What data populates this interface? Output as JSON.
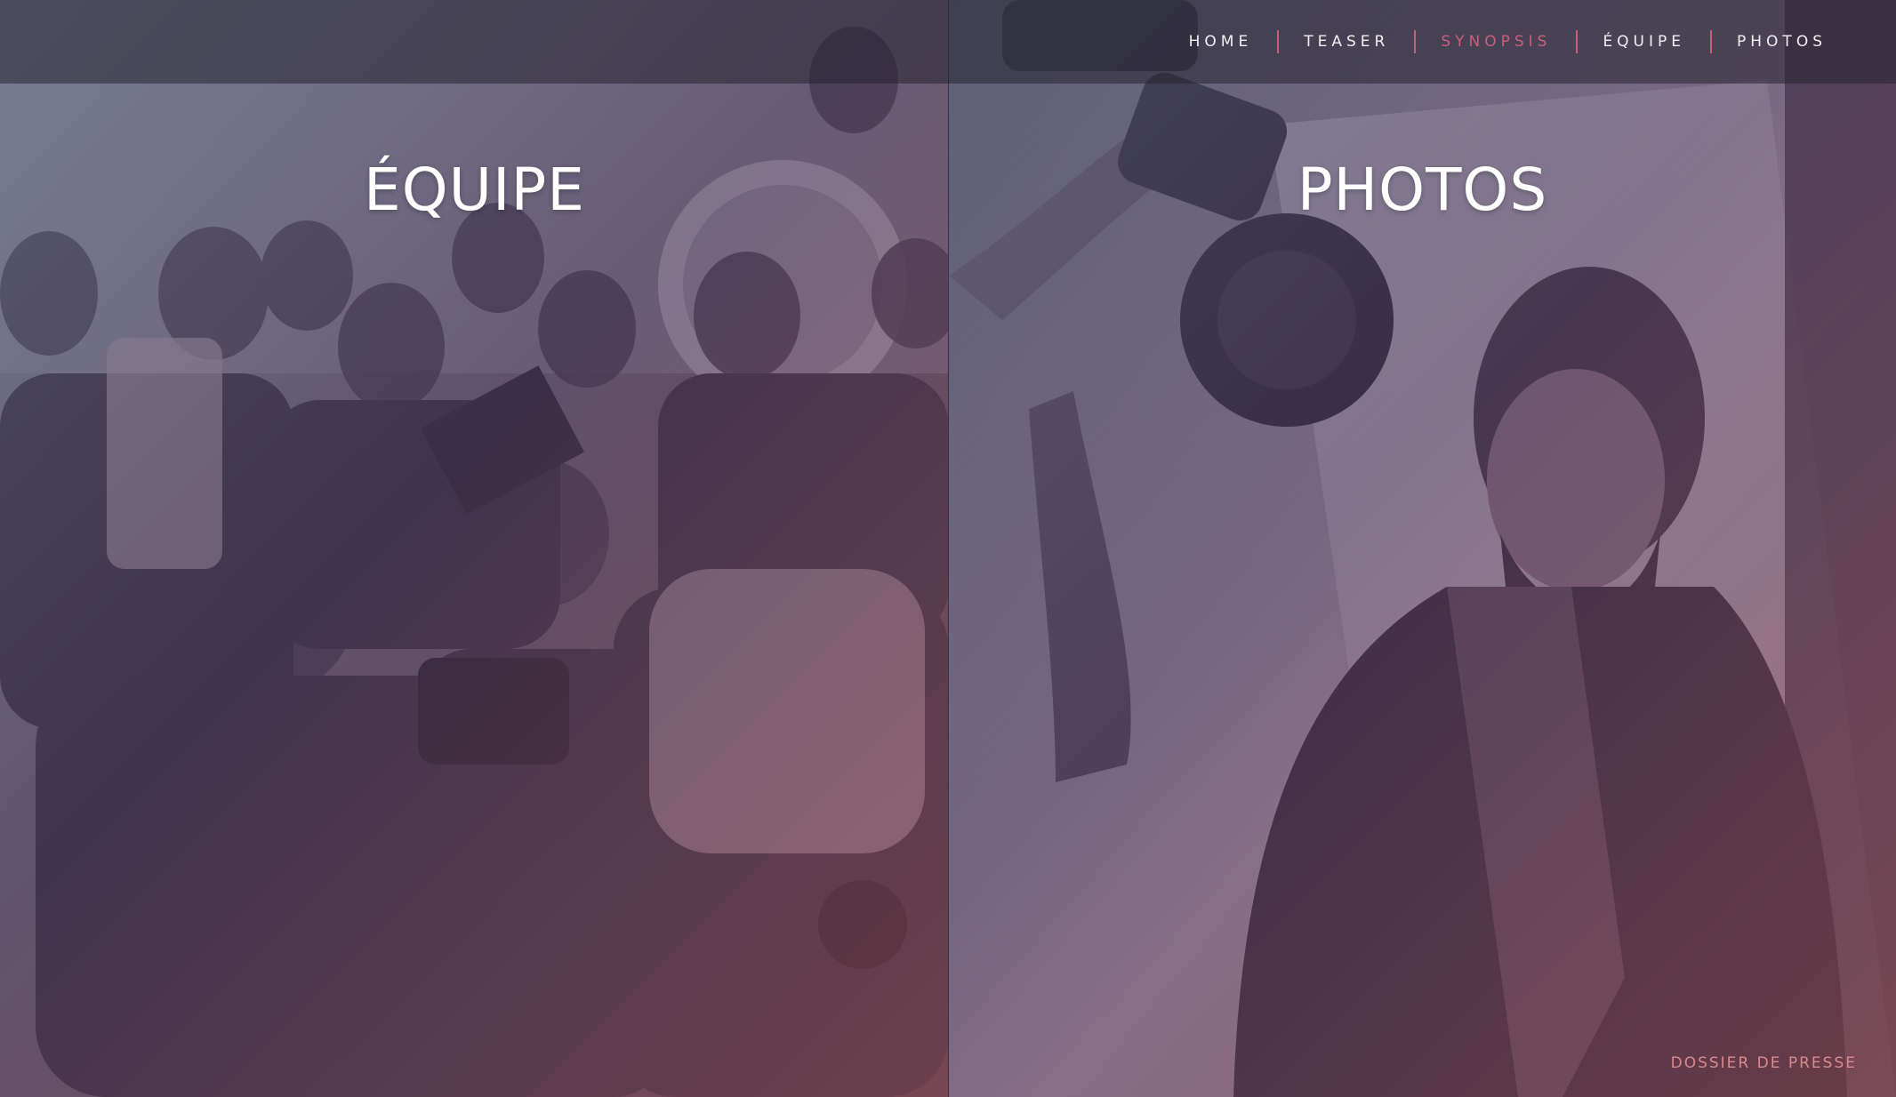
{
  "nav": {
    "items": [
      {
        "label": "HOME",
        "active": false
      },
      {
        "label": "TEASER",
        "active": false
      },
      {
        "label": "SYNOPSIS",
        "active": true
      },
      {
        "label": "ÉQUIPE",
        "active": false
      },
      {
        "label": "PHOTOS",
        "active": false
      }
    ],
    "active_color": "#c9607a"
  },
  "panels": {
    "left": {
      "title": "ÉQUIPE"
    },
    "right": {
      "title": "PHOTOS"
    }
  },
  "footer": {
    "press_link": "DOSSIER DE PRESSE"
  },
  "colors": {
    "accent": "#c9607a",
    "overlay_tint": "#6a5a80"
  }
}
